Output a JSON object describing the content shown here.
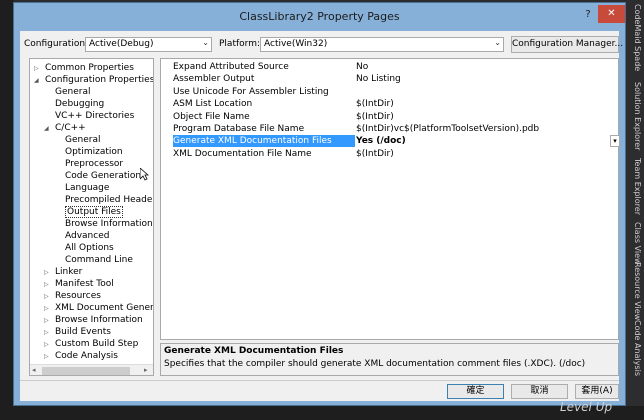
{
  "dialog": {
    "title": "ClassLibrary2 Property Pages",
    "help": "?",
    "close": "✕"
  },
  "configuration": {
    "label": "Configuration:",
    "value": "Active(Debug)"
  },
  "platform": {
    "label": "Platform:",
    "value": "Active(Win32)"
  },
  "config_manager_button": "Configuration Manager...",
  "tree": [
    {
      "label": "Common Properties",
      "level": 0,
      "twisty": "▷"
    },
    {
      "label": "Configuration Properties",
      "level": 0,
      "twisty": "◢"
    },
    {
      "label": "General",
      "level": 1
    },
    {
      "label": "Debugging",
      "level": 1
    },
    {
      "label": "VC++ Directories",
      "level": 1
    },
    {
      "label": "C/C++",
      "level": 1,
      "twisty": "◢"
    },
    {
      "label": "General",
      "level": 2
    },
    {
      "label": "Optimization",
      "level": 2
    },
    {
      "label": "Preprocessor",
      "level": 2
    },
    {
      "label": "Code Generation",
      "level": 2
    },
    {
      "label": "Language",
      "level": 2
    },
    {
      "label": "Precompiled Headers",
      "level": 2
    },
    {
      "label": "Output Files",
      "level": 2,
      "selected": true
    },
    {
      "label": "Browse Information",
      "level": 2
    },
    {
      "label": "Advanced",
      "level": 2
    },
    {
      "label": "All Options",
      "level": 2
    },
    {
      "label": "Command Line",
      "level": 2
    },
    {
      "label": "Linker",
      "level": 1,
      "twisty": "▷"
    },
    {
      "label": "Manifest Tool",
      "level": 1,
      "twisty": "▷"
    },
    {
      "label": "Resources",
      "level": 1,
      "twisty": "▷"
    },
    {
      "label": "XML Document Generator",
      "level": 1,
      "twisty": "▷"
    },
    {
      "label": "Browse Information",
      "level": 1,
      "twisty": "▷"
    },
    {
      "label": "Build Events",
      "level": 1,
      "twisty": "▷"
    },
    {
      "label": "Custom Build Step",
      "level": 1,
      "twisty": "▷"
    },
    {
      "label": "Code Analysis",
      "level": 1,
      "twisty": "▷"
    }
  ],
  "properties": [
    {
      "name": "Expand Attributed Source",
      "value": "No"
    },
    {
      "name": "Assembler Output",
      "value": "No Listing"
    },
    {
      "name": "Use Unicode For Assembler Listing",
      "value": ""
    },
    {
      "name": "ASM List Location",
      "value": "$(IntDir)"
    },
    {
      "name": "Object File Name",
      "value": "$(IntDir)"
    },
    {
      "name": "Program Database File Name",
      "value": "$(IntDir)vc$(PlatformToolsetVersion).pdb"
    },
    {
      "name": "Generate XML Documentation Files",
      "value": "Yes (/doc)",
      "selected": true
    },
    {
      "name": "XML Documentation File Name",
      "value": "$(IntDir)"
    }
  ],
  "description": {
    "title": "Generate XML Documentation Files",
    "text": "Specifies that the compiler should generate XML documentation comment files (.XDC).     (/doc)"
  },
  "buttons": {
    "ok": "確定",
    "cancel": "取消",
    "apply": "套用(A)"
  },
  "side_tabs": [
    "CodeMaid Spade",
    "Solution Explorer",
    "Team Explorer",
    "Class View",
    "Resource View",
    "Code Analysis"
  ],
  "watermark": "Level Up"
}
